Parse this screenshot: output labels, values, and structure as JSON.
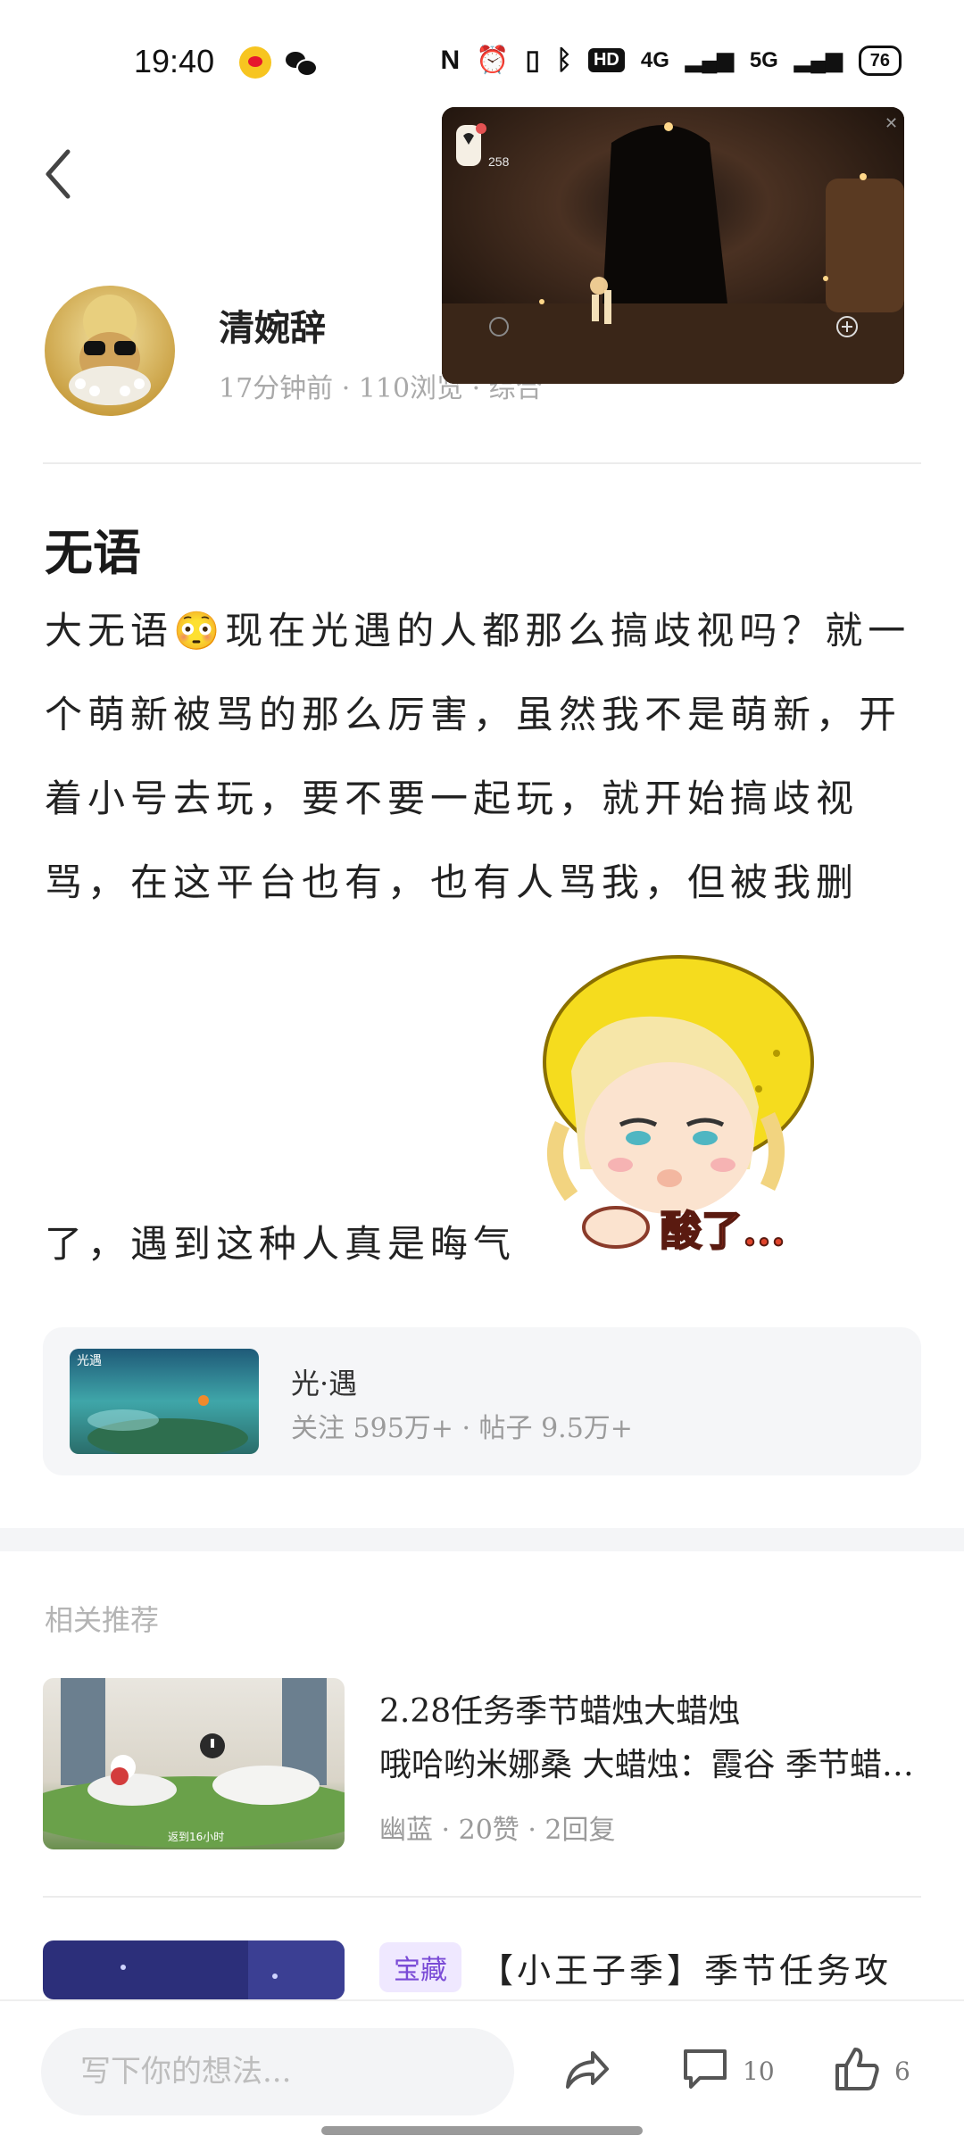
{
  "status_bar": {
    "time": "19:40",
    "network_4g": "4G",
    "network_5g": "5G",
    "hd_label": "HD",
    "battery": "76",
    "notification_icons": [
      "weibo-icon",
      "wechat-icon"
    ]
  },
  "video_overlay": {
    "counter": "258"
  },
  "author": {
    "name": "清婉辞",
    "meta": "17分钟前 · 110浏览 · 综合"
  },
  "post": {
    "title": "无语",
    "body": "大无语😳现在光遇的人都那么搞歧视吗？就一个萌新被骂的那么厉害，虽然我不是萌新，开着小号去玩，要不要一起玩，就开始搞歧视骂，在这平台也有，也有人骂我，但被我删",
    "body_tail": "了，遇到这种人真是晦气",
    "sticker_text": "酸了..."
  },
  "topic": {
    "thumb_label": "光遇",
    "name": "光·遇",
    "stats": "关注 595万+ · 帖子 9.5万+"
  },
  "related": {
    "heading": "相关推荐",
    "items": [
      {
        "title": "2.28任务季节蜡烛大蜡烛",
        "desc": "哦哈哟米娜桑 大蜡烛：霞谷 季节蜡烛...",
        "meta": "幽蓝 · 20赞 · 2回复",
        "thumb_caption": "返到16小时"
      },
      {
        "tag": "宝藏",
        "title": "【小王子季】季节任务攻"
      }
    ]
  },
  "bottom_bar": {
    "input_placeholder": "写下你的想法...",
    "comment_count": "10",
    "like_count": "6"
  },
  "colors": {
    "accent_purple": "#7a4bd6",
    "meta_gray": "#a9a9a9",
    "card_bg": "#f5f6f8"
  }
}
